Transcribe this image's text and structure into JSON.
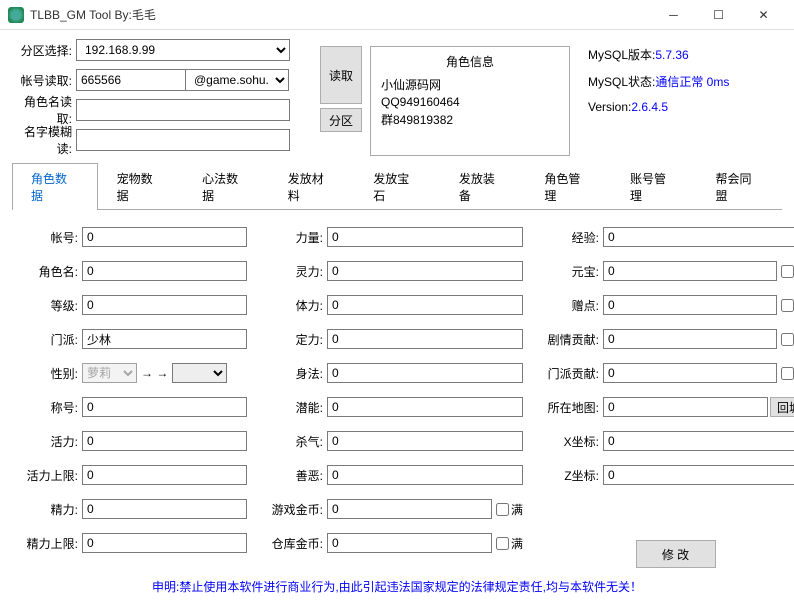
{
  "window": {
    "title": "TLBB_GM Tool By:毛毛"
  },
  "top": {
    "region_label": "分区选择:",
    "region_value": "192.168.9.99",
    "account_label": "帐号读取:",
    "account_value": "665566",
    "account_domain": "@game.sohu.com",
    "rolename_label": "角色名读取:",
    "rolename_value": "",
    "fuzzy_label": "名字模糊读:",
    "fuzzy_value": "",
    "read_btn": "读取",
    "partition_btn": "分区"
  },
  "info": {
    "header": "角色信息",
    "lines": [
      "小仙源码网",
      "QQ949160464",
      "群849819382"
    ]
  },
  "status": {
    "mysql_ver_label": "MySQL版本:",
    "mysql_ver": "5.7.36",
    "mysql_state_label": "MySQL状态:",
    "mysql_state": "通信正常  0ms",
    "version_label": "Version:",
    "version": "2.6.4.5"
  },
  "tabs": [
    "角色数据",
    "宠物数据",
    "心法数据",
    "发放材料",
    "发放宝石",
    "发放装备",
    "角色管理",
    "账号管理",
    "帮会同盟"
  ],
  "fields": {
    "col1": {
      "account": "帐号:",
      "rolename": "角色名:",
      "level": "等级:",
      "faction": "门派:",
      "sex": "性别:",
      "title": "称号:",
      "vigor": "活力:",
      "vigor_max": "活力上限:",
      "energy": "精力:",
      "energy_max": "精力上限:"
    },
    "col2": {
      "str": "力量:",
      "spirit": "灵力:",
      "con": "体力:",
      "calm": "定力:",
      "agi": "身法:",
      "potential": "潜能:",
      "sha": "杀气:",
      "good": "善恶:",
      "gold": "游戏金币:",
      "bank": "仓库金币:"
    },
    "col3": {
      "exp": "经验:",
      "yuanbao": "元宝:",
      "gift": "赠点:",
      "drama": "剧情贡献:",
      "faction_contrib": "门派贡献:",
      "map": "所在地图:",
      "x": "X坐标:",
      "z": "Z坐标:"
    },
    "values": {
      "account": "0",
      "rolename": "0",
      "level": "0",
      "faction": "少林",
      "sex": "萝莉",
      "title": "0",
      "vigor": "0",
      "vigor_max": "0",
      "energy": "0",
      "energy_max": "0",
      "str": "0",
      "spirit": "0",
      "con": "0",
      "calm": "0",
      "agi": "0",
      "potential": "0",
      "sha": "0",
      "good": "0",
      "gold": "0",
      "bank": "0",
      "exp": "0",
      "yuanbao": "0",
      "gift": "0",
      "drama": "0",
      "faction_contrib": "0",
      "map": "0",
      "x": "0",
      "z": "0"
    },
    "full_label": "满",
    "back_city": "回城",
    "modify": "修 改"
  },
  "footer": "申明:禁止使用本软件进行商业行为,由此引起违法国家规定的法律规定责任,均与本软件无关！"
}
